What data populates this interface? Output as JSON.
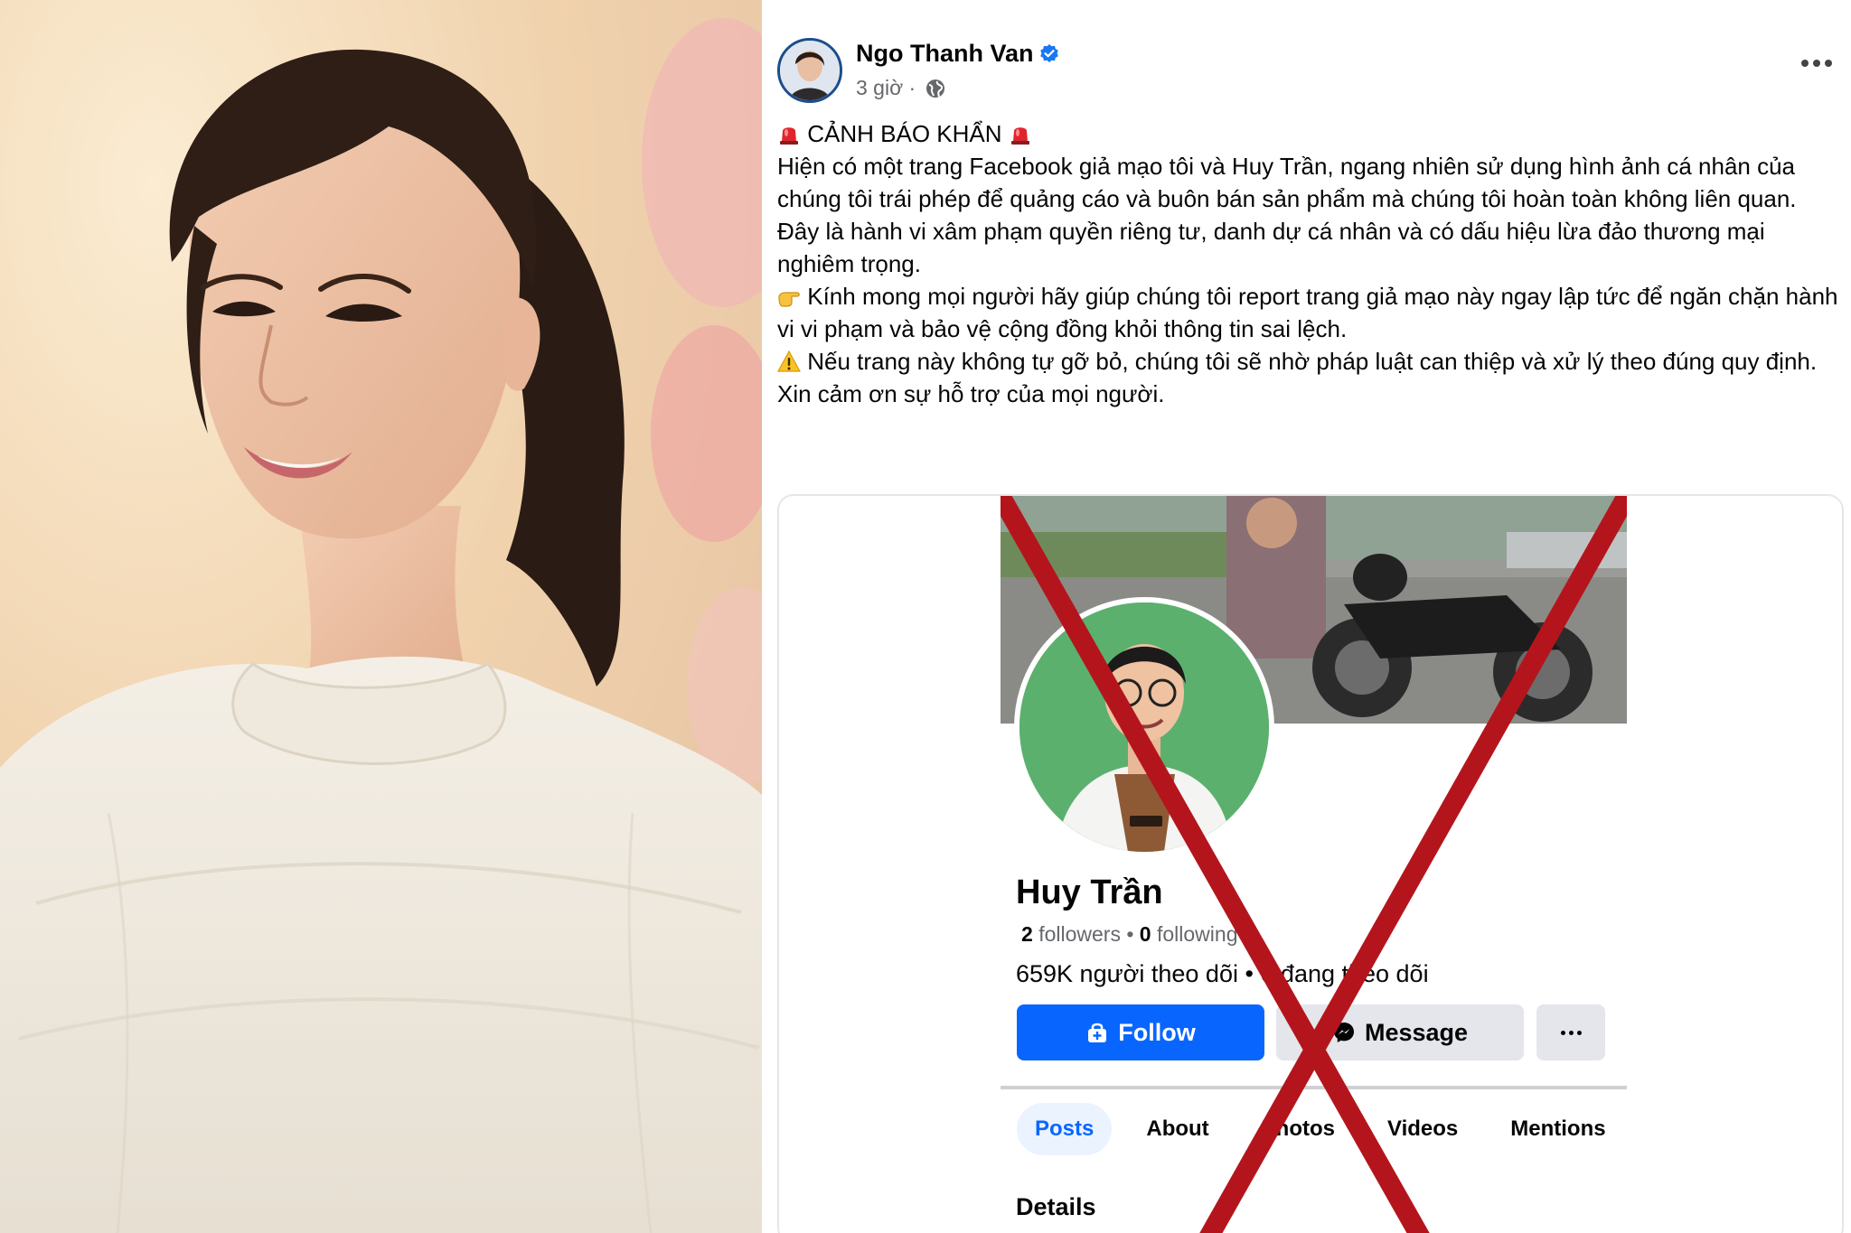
{
  "post": {
    "author": "Ngo Thanh Van",
    "time": "3 giờ ·",
    "alert_title": "CẢNH BÁO KHẨN",
    "paragraphs": [
      "Hiện có một trang Facebook giả mạo tôi và Huy Trần, ngang nhiên sử dụng hình ảnh cá nhân của chúng tôi trái phép để quảng cáo và buôn bán sản phẩm mà chúng tôi hoàn toàn không liên quan.",
      "Đây là hành vi xâm phạm quyền riêng tư, danh dự cá nhân và có dấu hiệu lừa đảo thương mại nghiêm trọng.",
      "Kính mong mọi người hãy giúp chúng tôi report trang giả mạo này ngay lập tức để ngăn chặn hành vi vi phạm và bảo vệ cộng đồng khỏi thông tin sai lệch.",
      "Nếu trang này không tự gỡ bỏ, chúng tôi sẽ nhờ pháp luật can thiệp và xử lý theo đúng quy định.",
      "Xin cảm ơn sự hỗ trợ của mọi người."
    ]
  },
  "profile": {
    "name": "Huy Trần",
    "followers_count": "2",
    "followers_label": "followers",
    "following_count": "0",
    "following_label": "following",
    "followers_vn": "659K người theo dõi • 6 đang theo dõi",
    "follow_label": "Follow",
    "message_label": "Message",
    "tabs": [
      "Posts",
      "About",
      "Photos",
      "Videos",
      "Mentions"
    ],
    "details_heading": "Details"
  },
  "icons": {
    "verified": "verified-badge-icon",
    "globe": "globe-icon",
    "siren": "siren-icon",
    "point": "pointing-hand-icon",
    "warning": "warning-icon"
  },
  "colors": {
    "facebook_blue": "#0866ff",
    "cross_red": "#b4151c"
  }
}
